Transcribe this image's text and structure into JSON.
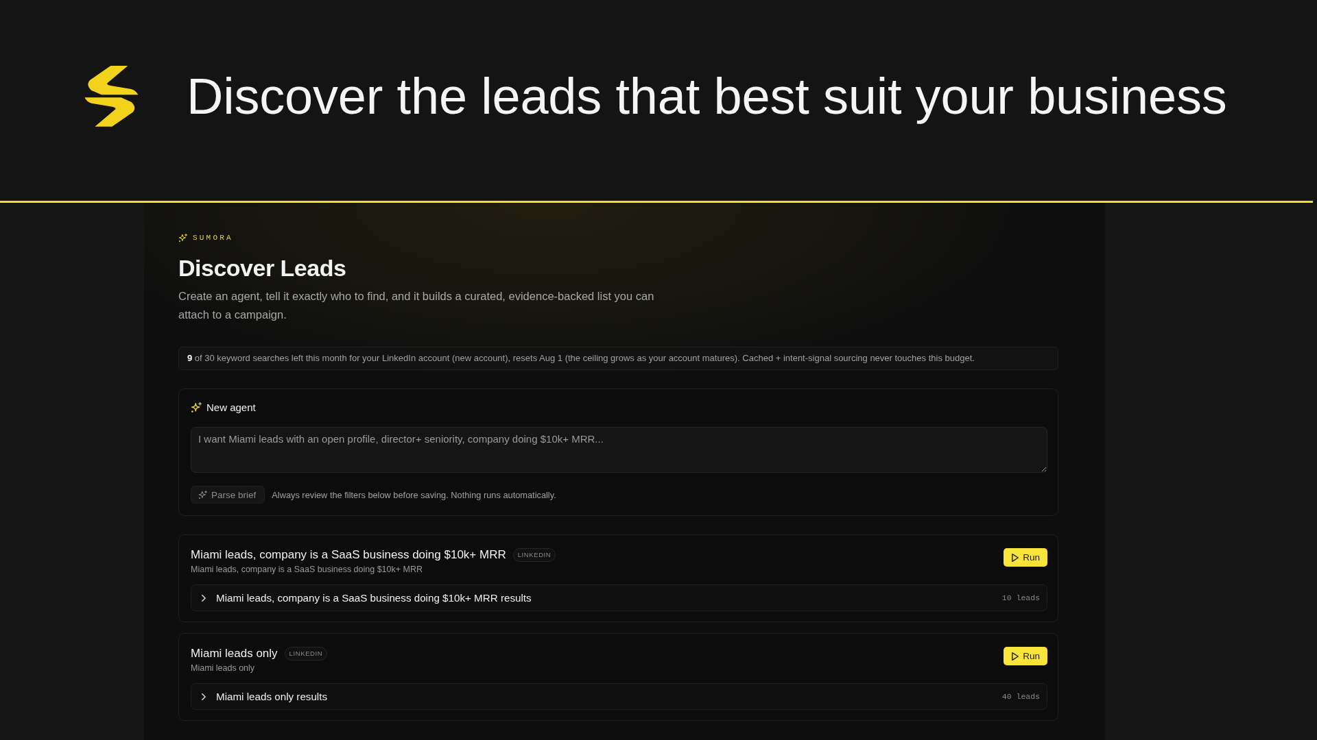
{
  "hero": {
    "headline": "Discover the leads that best suit your business"
  },
  "page": {
    "brand": "SUMORA",
    "title": "Discover Leads",
    "description": "Create an agent, tell it exactly who to find, and it builds a curated, evidence-backed list you can attach to a campaign."
  },
  "quota_notice": {
    "text": "**9** of 30 keyword searches left this month for your LinkedIn account (new account), resets Aug 1 (the ceiling grows as your account matures). Cached + intent-signal sourcing never touches this budget."
  },
  "new_agent": {
    "title": "New agent",
    "brief": {
      "placeholder": "I want Miami leads with an open profile, director+ seniority, company doing $10k+ MRR..."
    },
    "parse_button": {
      "label": "Parse brief",
      "disabled": true
    },
    "hint": "Always review the filters below before saving. Nothing runs automatically."
  },
  "agents": [
    {
      "name": "Miami leads, company is a SaaS business doing $10k+ MRR",
      "source": "LINKEDIN",
      "summary": "Miami leads, company is a SaaS business doing $10k+ MRR",
      "run_button": "Run",
      "results": {
        "label": "Miami leads, company is a SaaS business doing $10k+ MRR results",
        "count": "10 leads",
        "expanded": false
      }
    },
    {
      "name": "Miami leads only",
      "source": "LINKEDIN",
      "summary": "Miami leads only",
      "run_button": "Run",
      "results": {
        "label": "Miami leads only results",
        "count": "40 leads",
        "expanded": false
      }
    }
  ]
}
